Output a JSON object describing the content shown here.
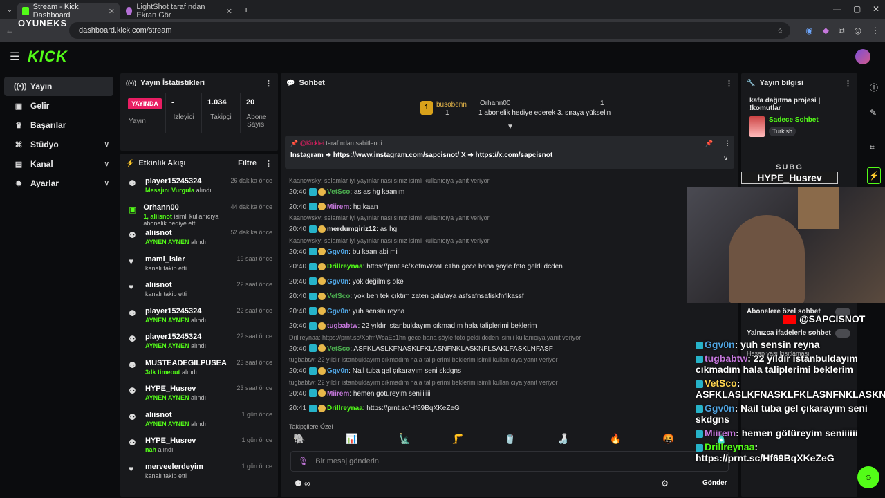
{
  "browser": {
    "tabs": [
      {
        "label": "Stream - Kick Dashboard",
        "active": true
      },
      {
        "label": "LightShot tarafından Ekran Gör",
        "active": false
      }
    ],
    "url": "dashboard.kick.com/stream",
    "overlay_logo": "OYUNEKS"
  },
  "brand": {
    "logo": "KICK",
    "accent": "#53fc18"
  },
  "sidebar": {
    "items": [
      {
        "label": "Yayın",
        "icon": "broadcast-icon",
        "active": true,
        "chevron": false
      },
      {
        "label": "Gelir",
        "icon": "revenue-icon",
        "active": false,
        "chevron": false
      },
      {
        "label": "Başarılar",
        "icon": "trophy-icon",
        "active": false,
        "chevron": false
      },
      {
        "label": "Stüdyo",
        "icon": "studio-icon",
        "active": false,
        "chevron": true
      },
      {
        "label": "Kanal",
        "icon": "channel-icon",
        "active": false,
        "chevron": true
      },
      {
        "label": "Ayarlar",
        "icon": "gear-icon",
        "active": false,
        "chevron": true
      }
    ]
  },
  "stats": {
    "title": "Yayın İstatistikleri",
    "live_badge": "YAYINDA",
    "items": [
      {
        "value": "",
        "label": "Yayın"
      },
      {
        "value": "-",
        "label": "İzleyici"
      },
      {
        "value": "1.034",
        "label": "Takipçi"
      },
      {
        "value": "20",
        "label": "Abone Sayısı"
      }
    ]
  },
  "activity": {
    "title": "Etkinlik Akışı",
    "filter_label": "Filtre",
    "items": [
      {
        "name": "player15245324",
        "desc_highlight": "Mesajını Vurgula",
        "desc": "alındı",
        "time": "26 dakika önce",
        "icon": "gift-icon"
      },
      {
        "name": "Orhann00",
        "desc_highlight": "1, aliisnot",
        "desc": "isimli kullanıcıya abonelik hediye etti.",
        "time": "44 dakika önce",
        "icon": "subscription-icon"
      },
      {
        "name": "aliisnot",
        "desc_highlight": "AYNEN AYNEN",
        "desc": "alındı",
        "time": "52 dakika önce",
        "icon": "gift-icon"
      },
      {
        "name": "mami_isler",
        "desc_highlight": "",
        "desc": "kanalı takip etti",
        "time": "19 saat önce",
        "icon": "heart-icon"
      },
      {
        "name": "aliisnot",
        "desc_highlight": "",
        "desc": "kanalı takip etti",
        "time": "22 saat önce",
        "icon": "heart-icon"
      },
      {
        "name": "player15245324",
        "desc_highlight": "AYNEN AYNEN",
        "desc": "alındı",
        "time": "22 saat önce",
        "icon": "gift-icon"
      },
      {
        "name": "player15245324",
        "desc_highlight": "AYNEN AYNEN",
        "desc": "alındı",
        "time": "22 saat önce",
        "icon": "gift-icon"
      },
      {
        "name": "MUSTEADEGILPUSEA",
        "desc_highlight": "3dk timeout",
        "desc": "alındı",
        "time": "23 saat önce",
        "icon": "gift-icon"
      },
      {
        "name": "HYPE_Husrev",
        "desc_highlight": "AYNEN AYNEN",
        "desc": "alındı",
        "time": "23 saat önce",
        "icon": "gift-icon"
      },
      {
        "name": "aliisnot",
        "desc_highlight": "AYNEN AYNEN",
        "desc": "alındı",
        "time": "1 gün önce",
        "icon": "gift-icon"
      },
      {
        "name": "HYPE_Husrev",
        "desc_highlight": "nah",
        "desc": "alındı",
        "time": "1 gün önce",
        "icon": "gift-icon"
      },
      {
        "name": "merveelerdeyim",
        "desc_highlight": "",
        "desc": "kanalı takip etti",
        "time": "1 gün önce",
        "icon": "heart-icon"
      }
    ]
  },
  "chat": {
    "title": "Sohbet",
    "leaderboard": [
      {
        "name": "busobenn",
        "count": "1"
      },
      {
        "name": "Orhann00",
        "count": "1"
      }
    ],
    "gift_text": "1 abonelik hediye ederek 3. sıraya yükselin",
    "pinned_by": "tarafından sabitlendi",
    "pinned_user": "@Kicklei",
    "pinned_text": "Instagram ➜ https://www.instagram.com/sapcisnot/ X ➜ https://x.com/sapcisnot",
    "messages": [
      {
        "reply": "Kaanowsky: selamlar iyi yayınlar nasılsınız isimli kullanıcıya yanıt veriyor",
        "time": "20:40",
        "user": "VetSco",
        "color": "#4caf50",
        "text": "as as hg kaanım"
      },
      {
        "reply": "",
        "time": "20:40",
        "user": "Miirem",
        "color": "#c678dd",
        "text": "hg kaan"
      },
      {
        "reply": "Kaanowsky: selamlar iyi yayınlar nasılsınız isimli kullanıcıya yanıt veriyor",
        "time": "20:40",
        "user": "merdumgiriz12",
        "color": "#e8e8e8",
        "text": "as hg"
      },
      {
        "reply": "Kaanowsky: selamlar iyi yayınlar nasılsınız isimli kullanıcıya yanıt veriyor",
        "time": "20:40",
        "user": "Ggv0n",
        "color": "#4fa3e0",
        "text": "bu kaan abi mi"
      },
      {
        "reply": "",
        "time": "20:40",
        "user": "Drillreynaa",
        "color": "#53fc18",
        "text": "https://prnt.sc/XofmWcaEc1hn gece bana şöyle foto geldi dcden"
      },
      {
        "reply": "",
        "time": "20:40",
        "user": "Ggv0n",
        "color": "#4fa3e0",
        "text": "yok değilmiş oke"
      },
      {
        "reply": "",
        "time": "20:40",
        "user": "VetSco",
        "color": "#4caf50",
        "text": "yok ben tek çıktım zaten galataya asfsafnsafiskfnflkassf"
      },
      {
        "reply": "",
        "time": "20:40",
        "user": "Ggv0n",
        "color": "#4fa3e0",
        "text": "yuh sensin reyna"
      },
      {
        "reply": "",
        "time": "20:40",
        "user": "tugbabtw",
        "color": "#c678dd",
        "text": "22 yıldır istanbuldayım cıkmadım hala taliplerimi beklerim"
      },
      {
        "reply": "Drillreynaa: https://prnt.sc/XofmWcaEc1hn gece bana şöyle foto geldi dcden isimli kullanıcıya yanıt veriyor",
        "time": "20:40",
        "user": "VetSco",
        "color": "#4caf50",
        "text": "ASFKLASLKFNASKLFKLASNFNKLASKNFLSAKLFASKLNFASF"
      },
      {
        "reply": "tugbabtw: 22 yıldır istanbuldayım cıkmadım hala taliplerimi beklerim isimli kullanıcıya yanıt veriyor",
        "time": "20:40",
        "user": "Ggv0n",
        "color": "#4fa3e0",
        "text": "Nail tuba gel çıkarayım seni skdgns"
      },
      {
        "reply": "tugbabtw: 22 yıldır istanbuldayım cıkmadım hala taliplerimi beklerim isimli kullanıcıya yanıt veriyor",
        "time": "20:40",
        "user": "Miirem",
        "color": "#c678dd",
        "text": "hemen götüreyim seniiiiiii"
      },
      {
        "reply": "",
        "time": "20:41",
        "user": "Drillreynaa",
        "color": "#53fc18",
        "text": "https://prnt.sc/Hf69BqXKeZeG"
      }
    ],
    "emote_bar_label": "Takipçilere Özel",
    "input_placeholder": "Bir mesaj gönderin",
    "send_label": "Gönder"
  },
  "stream_info": {
    "title": "Yayın bilgisi",
    "stream_title": "kafa dağıtma projesi | !komutlar",
    "category": "Sadece Sohbet",
    "tag": "Turkish",
    "toggles": [
      {
        "label": "Abonelere özel sohbet"
      },
      {
        "label": "Yalnızca ifadelerle sohbet"
      },
      {
        "label": "Hesap yaşı kısıtlaması"
      }
    ]
  },
  "overlay": {
    "sub_badge": "SUBG",
    "hype_name": "HYPE_Husrev",
    "youtube_handle": "@SAPCISNOT",
    "chat_lines": [
      {
        "user": "Ggv0n",
        "color": "#4fa3e0",
        "text": "yuh sensin reyna"
      },
      {
        "user": "tugbabtw",
        "color": "#c678dd",
        "text": "22 yıldır istanbuldayım cıkmadım hala taliplerimi beklerim"
      },
      {
        "user": "VetSco",
        "color": "#ffd54f",
        "text": "ASFKLASLKFNASKLFKLASNFNKLASKNFLSAKL"
      },
      {
        "user": "Ggv0n",
        "color": "#4fa3e0",
        "text": "Nail tuba gel çıkarayım seni skdgns"
      },
      {
        "user": "Miirem",
        "color": "#c678dd",
        "text": "hemen götüreyim seniiiiii"
      },
      {
        "user": "Drillreynaa",
        "color": "#53fc18",
        "text": "https://prnt.sc/Hf69BqXKeZeG"
      }
    ]
  }
}
